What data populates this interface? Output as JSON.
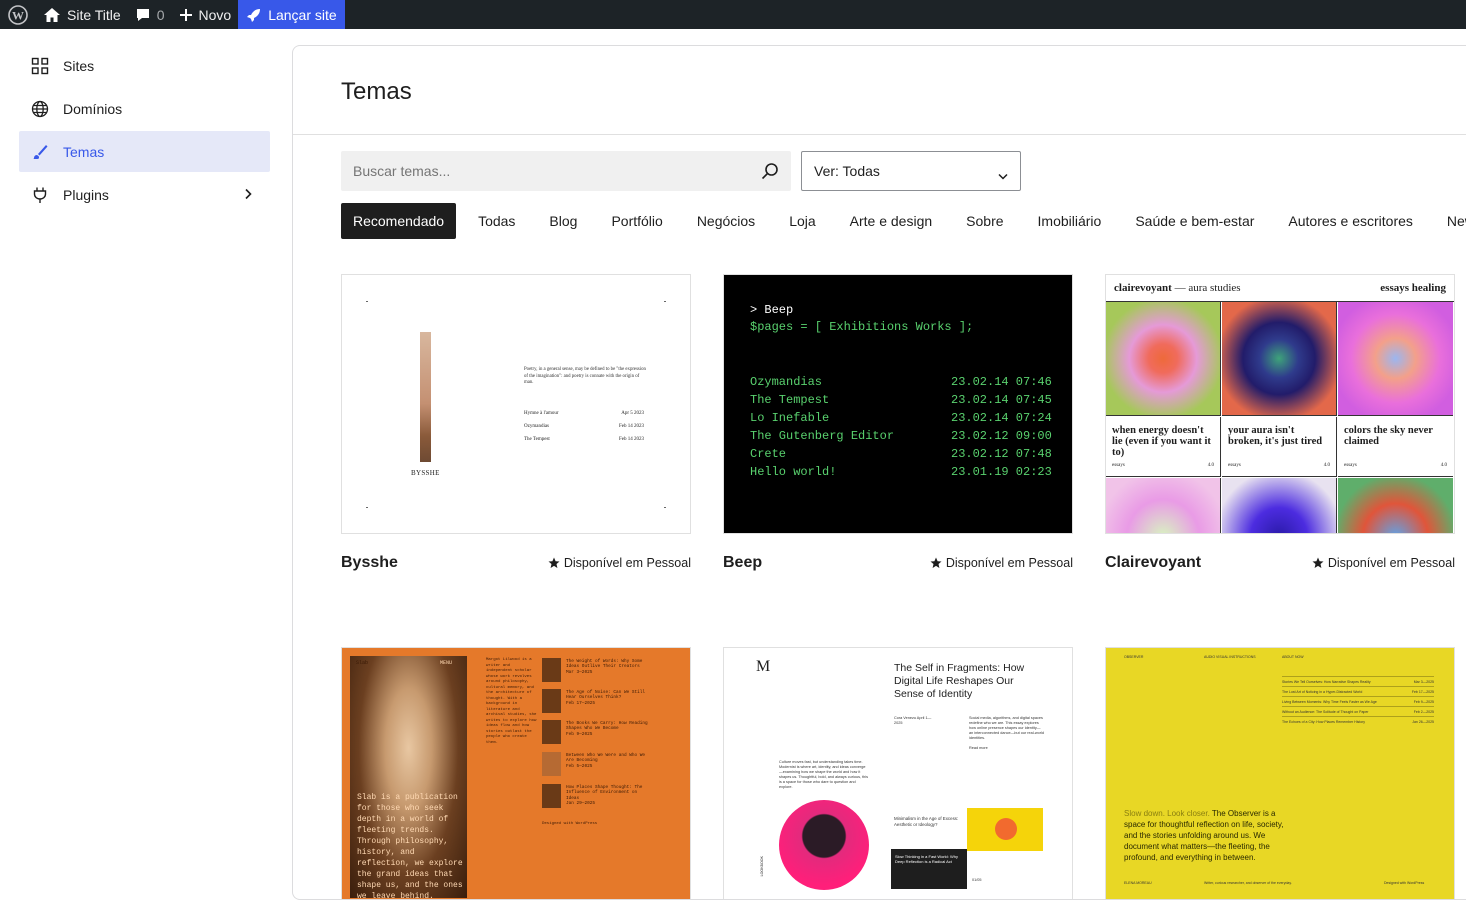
{
  "adminbar": {
    "site_title": "Site Title",
    "comments_count": "0",
    "new_label": "Novo",
    "launch_label": "Lançar site"
  },
  "sidebar": {
    "items": [
      {
        "label": "Sites",
        "icon": "grid-icon"
      },
      {
        "label": "Domínios",
        "icon": "globe-icon"
      },
      {
        "label": "Temas",
        "icon": "brush-icon",
        "active": true
      },
      {
        "label": "Plugins",
        "icon": "plug-icon"
      }
    ]
  },
  "main": {
    "title": "Temas",
    "search_placeholder": "Buscar temas...",
    "filter_label": "Ver: Todas",
    "tabs": [
      "Recomendado",
      "Todas",
      "Blog",
      "Portfólio",
      "Negócios",
      "Loja",
      "Arte e design",
      "Sobre",
      "Imobiliário",
      "Saúde e bem-estar",
      "Autores e escritores",
      "New"
    ]
  },
  "themes": [
    {
      "name": "Bysshe",
      "availability": "Disponível em Pessoal"
    },
    {
      "name": "Beep",
      "availability": "Disponível em Pessoal"
    },
    {
      "name": "Clairevoyant",
      "availability": "Disponível em Pessoal"
    }
  ],
  "previews": {
    "bysshe": {
      "name": "BYSSHE",
      "quote": "Poetry, in a general sense, may be defined to be \"the expression of the imagination\": and poetry is connate with the origin of man.",
      "rows": [
        {
          "title": "Hymne à l'amour",
          "date": "Apr 5 2023"
        },
        {
          "title": "Ozymandias",
          "date": "Feb 14 2023"
        },
        {
          "title": "The Tempest",
          "date": "Feb 14 2023"
        }
      ]
    },
    "beep": {
      "prompt": "> Beep",
      "pages_line": "$pages = [ Exhibitions  Works ];",
      "posts": [
        {
          "title": "Ozymandias",
          "date": "23.02.14 07:46"
        },
        {
          "title": "The Tempest",
          "date": "23.02.14 07:45"
        },
        {
          "title": "Lo Inefable",
          "date": "23.02.14 07:24"
        },
        {
          "title": "The Gutenberg Editor",
          "date": "23.02.12 09:00"
        },
        {
          "title": "Crete",
          "date": "23.02.12 07:48"
        },
        {
          "title": "Hello world!",
          "date": "23.01.19 02:23"
        }
      ]
    },
    "clairevoyant": {
      "brand": "clairevoyant",
      "tagline": "— aura studies",
      "nav": "essays  healing",
      "captions": [
        {
          "text": "when energy doesn't lie (even if you want it to)",
          "tag": "essays",
          "num": "4.0"
        },
        {
          "text": "your aura isn't broken, it's just tired",
          "tag": "essays",
          "num": "4.0"
        },
        {
          "text": "colors the sky never claimed",
          "tag": "essays",
          "num": "4.0"
        }
      ],
      "colors": [
        "#f26b3a",
        "#2e2a8f",
        "#e86fd8"
      ]
    },
    "slab": {
      "brand": "Slab",
      "menu": "MENU",
      "bio": "Margot Lilwood is a writer and independent scholar whose work revolves around philosophy, cultural memory, and the architecture of thought. With a background in literature and archival studies, she writes to explore how ideas flow and how stories outlast the people who create them.",
      "headline": "Slab is a publication for those who seek depth in a world of fleeting trends. Through philosophy, history, and reflection, we explore the grand ideas that shape us, and the ones we leave behind.",
      "posts": [
        {
          "title": "The Weight of Words: Why Some Ideas Outlive Their Creators",
          "date": "Mar 3—2025"
        },
        {
          "title": "The Age of Noise: Can We Still Hear Ourselves Think?",
          "date": "Feb 17—2025"
        },
        {
          "title": "The Books We Carry: How Reading Shapes Who We Become",
          "date": "Feb 9—2025"
        },
        {
          "title": "Between Who We Were and Who We Are Becoming",
          "date": "Feb 5—2025"
        },
        {
          "title": "How Places Shape Thought: The Influence of Environment on Ideas",
          "date": "Jan 29—2025"
        }
      ],
      "footer": "Designed with WordPress"
    },
    "fragments": {
      "logo": "M",
      "headline": "The Self in Fragments: How Digital Life Reshapes Our Sense of Identity",
      "author": "Cora Venezu April 1—2025",
      "summary": "Social media, algorithms, and digital spaces redefine who we are. This essay explores how online presence shapes our identity—an interconnected dance—but our real-world identities.",
      "read_more": "Read more",
      "intro": "Culture moves fast, but understanding takes time. Modernist is where art, identity, and ideas converge—examining how we shape the world and how it shapes us. Thoughtful, bold, and always curious, this is a space for those who dare to question and explore.",
      "card1": "Minimalism in the Age of Excess: Aesthetic or Ideology?",
      "card2": "Slow Thinking in a Fast World: Why Deep Reflection is a Radical Act",
      "side_label": "LOOKBOOK",
      "counter": "01/05"
    },
    "observer": {
      "brand": "OBSERVER",
      "nav1": "AUDIO VISUAL INSTRUCTIONS",
      "nav2": "ABOUT  NOW",
      "posts": [
        {
          "title": "Stories We Tell Ourselves: How Narrative Shapes Reality",
          "date": "Mar 3—2025"
        },
        {
          "title": "The Lost Art of Noticing in a Hyper-Distracted World",
          "date": "Feb 17—2025"
        },
        {
          "title": "Living Between Moments: Why Time Feels Faster as We Age",
          "date": "Feb 9—2025"
        },
        {
          "title": "Without an Audience: The Solitude of Thought on Paper",
          "date": "Feb 2—2025"
        },
        {
          "title": "The Echoes of a City: How Places Remember History",
          "date": "Jan 26—2025"
        }
      ],
      "lead_light": "Slow down. Look closer.",
      "lead": "The Observer is a space for thoughtful reflection on life, society, and the stories unfolding around us. We document what matters—the fleeting, the profound, and everything in between.",
      "author": "ELENA MOREAU",
      "author_bio": "Writer, curious researcher, and observer of the everyday.",
      "footer": "Designed with WordPress"
    }
  },
  "colors": {
    "accent": "#3858e9",
    "adminbar": "#1d2327",
    "active_nav_bg": "#e5e8f8"
  }
}
